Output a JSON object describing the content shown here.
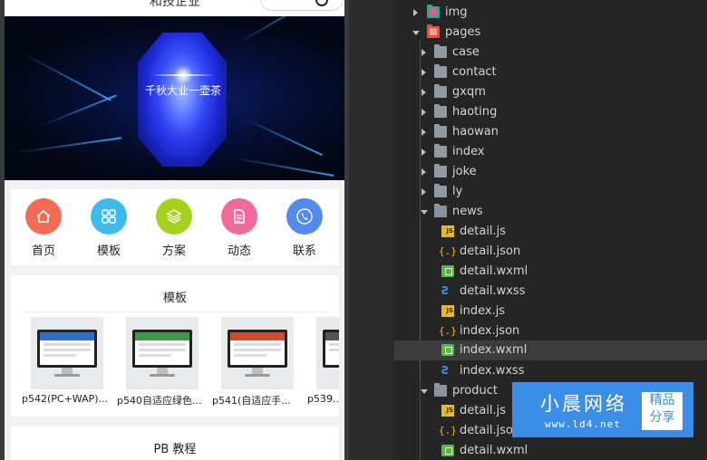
{
  "phone": {
    "nav_title": "和技企业",
    "banner_text": "千秋大业一壶茶",
    "nav_items": [
      {
        "label": "首页",
        "icon": "home-icon",
        "color": "#f26b55"
      },
      {
        "label": "模板",
        "icon": "grid-icon",
        "color": "#3cbcea"
      },
      {
        "label": "方案",
        "icon": "layers-icon",
        "color": "#a6d21d"
      },
      {
        "label": "动态",
        "icon": "document-icon",
        "color": "#f06b9b"
      },
      {
        "label": "联系",
        "icon": "phone-icon",
        "color": "#5489ef"
      }
    ],
    "templates_title": "模板",
    "templates": [
      {
        "name": "p542(PC+WAP)..."
      },
      {
        "name": "p540自适应绿色..."
      },
      {
        "name": "p541(自适应手..."
      },
      {
        "name": "p539..."
      }
    ],
    "tutorial_title": "PB 教程"
  },
  "tree": {
    "rows": [
      {
        "name": "img",
        "kind": "special-folder",
        "arrow": "right",
        "indent": 0
      },
      {
        "name": "pages",
        "kind": "special-folder-open",
        "arrow": "down",
        "indent": 0
      },
      {
        "name": "case",
        "kind": "folder",
        "arrow": "right",
        "indent": 1
      },
      {
        "name": "contact",
        "kind": "folder",
        "arrow": "right",
        "indent": 1
      },
      {
        "name": "gxqm",
        "kind": "folder",
        "arrow": "right",
        "indent": 1
      },
      {
        "name": "haoting",
        "kind": "folder",
        "arrow": "right",
        "indent": 1
      },
      {
        "name": "haowan",
        "kind": "folder",
        "arrow": "right",
        "indent": 1
      },
      {
        "name": "index",
        "kind": "folder",
        "arrow": "right",
        "indent": 1
      },
      {
        "name": "joke",
        "kind": "folder",
        "arrow": "right",
        "indent": 1
      },
      {
        "name": "ly",
        "kind": "folder",
        "arrow": "right",
        "indent": 1
      },
      {
        "name": "news",
        "kind": "folder-open",
        "arrow": "down",
        "indent": 1
      },
      {
        "name": "detail.js",
        "kind": "js",
        "indent": 2
      },
      {
        "name": "detail.json",
        "kind": "json",
        "indent": 2
      },
      {
        "name": "detail.wxml",
        "kind": "wxml",
        "indent": 2
      },
      {
        "name": "detail.wxss",
        "kind": "wxss",
        "indent": 2
      },
      {
        "name": "index.js",
        "kind": "js",
        "indent": 2
      },
      {
        "name": "index.json",
        "kind": "json",
        "indent": 2
      },
      {
        "name": "index.wxml",
        "kind": "wxml",
        "indent": 2,
        "selected": true
      },
      {
        "name": "index.wxss",
        "kind": "wxss",
        "indent": 2
      },
      {
        "name": "product",
        "kind": "folder-open",
        "arrow": "down",
        "indent": 1
      },
      {
        "name": "detail.js",
        "kind": "js",
        "indent": 2
      },
      {
        "name": "detail.json",
        "kind": "json",
        "indent": 2
      },
      {
        "name": "detail.wxml",
        "kind": "wxml",
        "indent": 2
      }
    ],
    "colors": {
      "img_folder": "#2aa889",
      "pages_folder": "#e2553d"
    }
  },
  "watermark": {
    "title": "小晨网络",
    "url": "www.ld4.net",
    "badge_line1": "精品",
    "badge_line2": "分享"
  }
}
